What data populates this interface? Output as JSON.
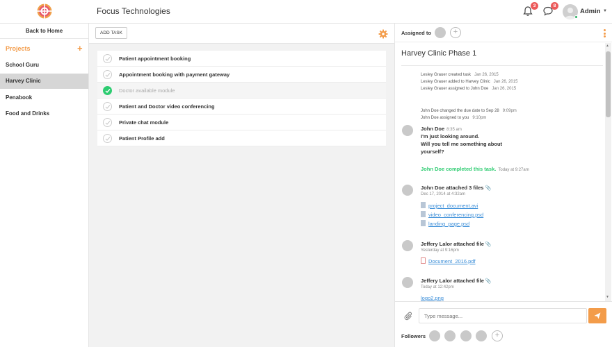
{
  "header": {
    "app_title": "Focus Technologies",
    "notifications_count": "3",
    "messages_count": "8",
    "user_name": "Admin",
    "icons": [
      "bell-icon",
      "chat-icon",
      "caret-down-icon"
    ],
    "accent_color": "#f39c4a",
    "badge_color": "#ec5a5a"
  },
  "sidebar": {
    "back_label": "Back to Home",
    "projects_label": "Projects",
    "add_symbol": "+",
    "items": [
      {
        "label": "School Guru"
      },
      {
        "label": "Harvey Clinic",
        "active": true
      },
      {
        "label": "Penabook"
      },
      {
        "label": "Food and Drinks"
      }
    ]
  },
  "tasks": {
    "add_label": "ADD TASK",
    "items": [
      {
        "label": "Patient appointment booking",
        "done": false
      },
      {
        "label": "Appointment booking with payment gateway",
        "done": false
      },
      {
        "label": "Doctor available module",
        "done": true
      },
      {
        "label": "Patient and Doctor video conferencing",
        "done": false
      },
      {
        "label": "Private chat module",
        "done": false
      },
      {
        "label": "Patient Profile add",
        "done": false
      }
    ]
  },
  "detail": {
    "assigned_label": "Assigned to",
    "add_symbol": "+",
    "title": "Harvey Clinic Phase 1",
    "log1": [
      {
        "text": "Lesley Grauer created task",
        "date": "Jan 26, 2015"
      },
      {
        "text": "Lesley Grauer added to Harvey Clinic",
        "date": "Jan 26, 2015"
      },
      {
        "text": "Lesley Grauer assigned to John Doe",
        "date": "Jan 26, 2015"
      }
    ],
    "log2": [
      {
        "text": "John Doe changed the due date to Sep 28",
        "date": "9:09pm"
      },
      {
        "text": "John Doe assigned to you",
        "date": "9:10pm"
      }
    ],
    "message": {
      "name": "John Doe",
      "time": "8:35 am",
      "lines": [
        "I'm just looking around.",
        "Will you tell me something about",
        "yourself?"
      ]
    },
    "completed": {
      "text": "John Doe completed this task.",
      "time": "Today at 9:27am"
    },
    "attach1": {
      "title": "John Doe attached 3 files",
      "date": "Dec 17, 2014 at 4:32am",
      "files": [
        "project_document.avi",
        "video_conferencing.psd",
        "landing_page.psd"
      ]
    },
    "attach2": {
      "title": "Jeffery Lalor attached file",
      "date": "Yesterday at 9:16pm",
      "file": "Document_2016.pdf"
    },
    "attach3": {
      "title": "Jeffery Lalor attached file",
      "date": "Today at 12:42pm",
      "file": "logo2.png"
    },
    "composer_placeholder": "Type message...",
    "followers_label": "Followers",
    "followers_add": "+"
  }
}
